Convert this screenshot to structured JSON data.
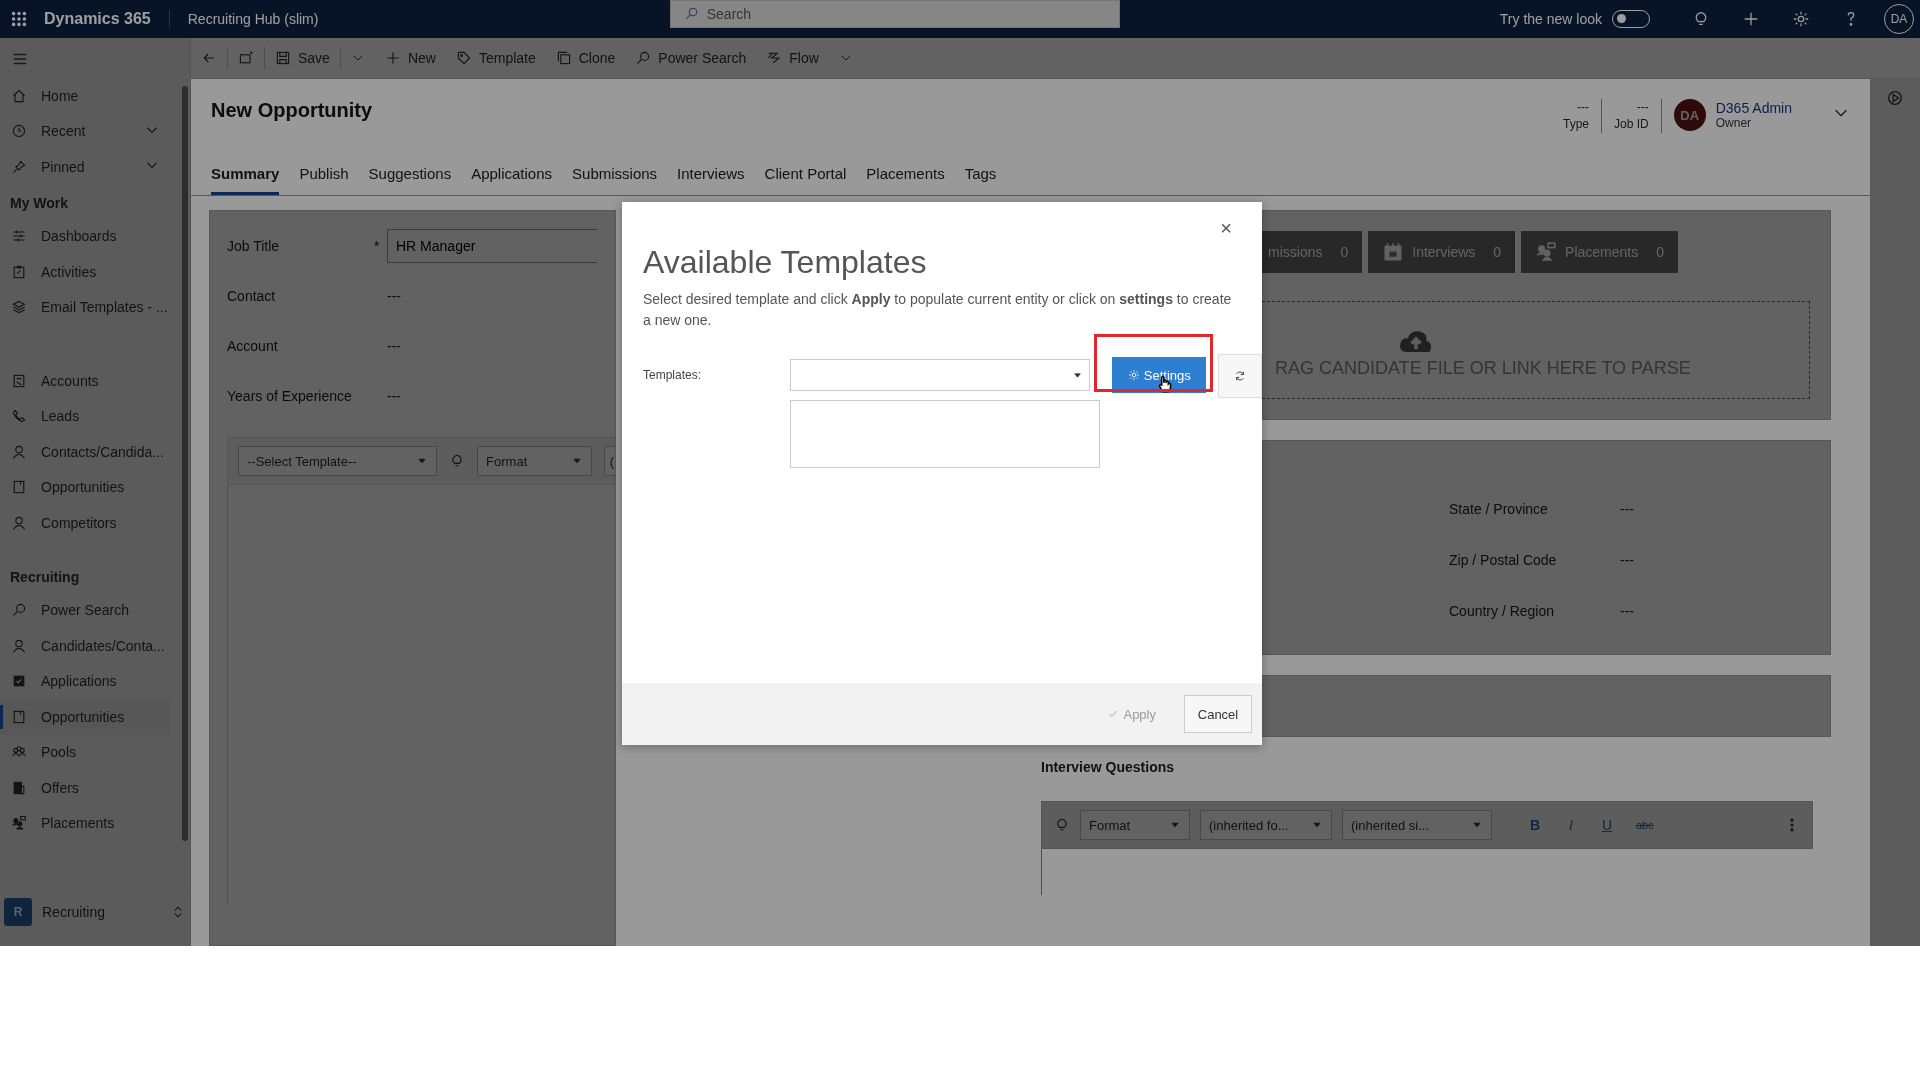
{
  "top_bar": {
    "app_name": "Dynamics 365",
    "area_title": "Recruiting Hub (slim)",
    "search": {
      "placeholder": "Search"
    },
    "new_look": {
      "label": "Try the new look",
      "on": false
    },
    "avatar": "DA"
  },
  "sidebar": {
    "sections": [
      {
        "items": [
          {
            "label": "Home",
            "kind": "link",
            "selected": false
          },
          {
            "label": "Recent",
            "kind": "flyout",
            "selected": false
          },
          {
            "label": "Pinned",
            "kind": "flyout",
            "selected": false
          }
        ]
      },
      {
        "heading": "My Work",
        "items": [
          {
            "label": "Dashboards",
            "kind": "link",
            "selected": false
          },
          {
            "label": "Activities",
            "kind": "link",
            "selected": false
          },
          {
            "label": "Email Templates - ...",
            "kind": "link",
            "selected": false
          }
        ]
      },
      {
        "items": [
          {
            "label": "Accounts",
            "kind": "link",
            "selected": false
          },
          {
            "label": "Leads",
            "kind": "link",
            "selected": false
          },
          {
            "label": "Contacts/Candida...",
            "kind": "link",
            "selected": false
          },
          {
            "label": "Opportunities",
            "kind": "link",
            "selected": false
          },
          {
            "label": "Competitors",
            "kind": "link",
            "selected": false
          }
        ]
      },
      {
        "heading": "Recruiting",
        "items": [
          {
            "label": "Power Search",
            "kind": "link",
            "selected": false
          },
          {
            "label": "Candidates/Conta...",
            "kind": "link",
            "selected": false
          },
          {
            "label": "Applications",
            "kind": "link",
            "selected": false
          },
          {
            "label": "Opportunities",
            "kind": "link",
            "selected": true
          },
          {
            "label": "Pools",
            "kind": "link",
            "selected": false
          },
          {
            "label": "Offers",
            "kind": "link",
            "selected": false
          },
          {
            "label": "Placements",
            "kind": "link",
            "selected": false
          }
        ]
      }
    ],
    "area_switcher": {
      "initial": "R",
      "label": "Recruiting"
    }
  },
  "command_bar": [
    {
      "label": "Save",
      "split": true
    },
    {
      "label": "New",
      "split": false
    },
    {
      "label": "Template",
      "split": false
    },
    {
      "label": "Clone",
      "split": false
    },
    {
      "label": "Power Search",
      "split": false
    },
    {
      "label": "Flow",
      "split": true
    }
  ],
  "header": {
    "title": "New Opportunity",
    "fields": [
      {
        "value": "---",
        "label": "Type"
      },
      {
        "value": "---",
        "label": "Job ID"
      }
    ],
    "owner": {
      "initials": "DA",
      "name": "D365 Admin",
      "role": "Owner"
    }
  },
  "tabs": [
    {
      "label": "Summary",
      "selected": true
    },
    {
      "label": "Publish",
      "selected": false
    },
    {
      "label": "Suggestions",
      "selected": false
    },
    {
      "label": "Applications",
      "selected": false
    },
    {
      "label": "Submissions",
      "selected": false
    },
    {
      "label": "Interviews",
      "selected": false
    },
    {
      "label": "Client Portal",
      "selected": false
    },
    {
      "label": "Placements",
      "selected": false
    },
    {
      "label": "Tags",
      "selected": false
    }
  ],
  "form": {
    "required_mark": "*",
    "fields": [
      {
        "label": "Job Title",
        "required": true,
        "kind": "input",
        "value": "HR Manager"
      },
      {
        "label": "Contact",
        "required": false,
        "kind": "text",
        "value": "---"
      },
      {
        "label": "Account",
        "required": false,
        "kind": "text",
        "value": "---"
      },
      {
        "label": "Years of Experience",
        "required": false,
        "kind": "text",
        "value": "---"
      }
    ],
    "editor_toolbar": {
      "template_select": "--Select Template--",
      "format_select": "Format",
      "next_select": "("
    }
  },
  "counters": [
    {
      "label": "missions",
      "count": "0"
    },
    {
      "label": "Interviews",
      "count": "0"
    },
    {
      "label": "Placements",
      "count": "0"
    }
  ],
  "drop_zone": {
    "text": "RAG CANDIDATE FILE OR LINK HERE TO PARSE"
  },
  "address": [
    {
      "label": "State / Province",
      "value": "---"
    },
    {
      "label": "Zip / Postal Code",
      "value": "---"
    },
    {
      "label": "Country / Region",
      "value": "---"
    }
  ],
  "interview_questions": {
    "title": "Interview Questions",
    "format": "Format",
    "font": "(inherited fo...",
    "size": "(inherited si...",
    "buttons": [
      {
        "kind": "bold",
        "label": "B"
      },
      {
        "kind": "italic",
        "label": "I"
      },
      {
        "kind": "underline",
        "label": "U"
      },
      {
        "kind": "strike",
        "label": "abc"
      }
    ]
  },
  "modal": {
    "close": "×",
    "title": "Available Templates",
    "description": "Select desired template and click **Apply** to populate current entity or click on **settings** to create a new one.",
    "templates_label": "Templates:",
    "settings_button": "Settings",
    "highlighted": true,
    "apply": {
      "label": "Apply",
      "disabled": true
    },
    "cancel": "Cancel"
  }
}
